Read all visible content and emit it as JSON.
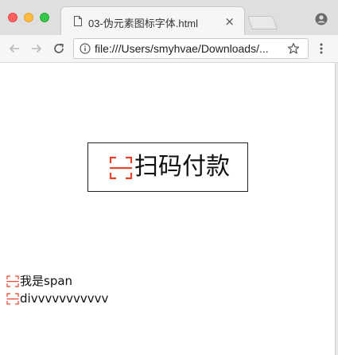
{
  "browser": {
    "tab_title": "03-伪元素图标字体.html",
    "tab_close": "×",
    "url": "file:///Users/smyhvae/Downloads/..."
  },
  "page": {
    "pay_button_label": "扫码付款",
    "span_text": "我是span",
    "div_text": "divvvvvvvvvvv"
  },
  "colors": {
    "scan_icon": "#e8412c",
    "traffic_red": "#fc605c",
    "traffic_yellow": "#fdbc40",
    "traffic_green": "#34c84a"
  },
  "icons": {
    "tab": "document-icon",
    "scan": "scan-icon",
    "nav": [
      "back-arrow-icon",
      "forward-arrow-icon",
      "reload-icon"
    ],
    "omnibox": [
      "info-icon",
      "star-icon"
    ],
    "menu": "kebab-menu-icon",
    "profile": "profile-icon"
  }
}
